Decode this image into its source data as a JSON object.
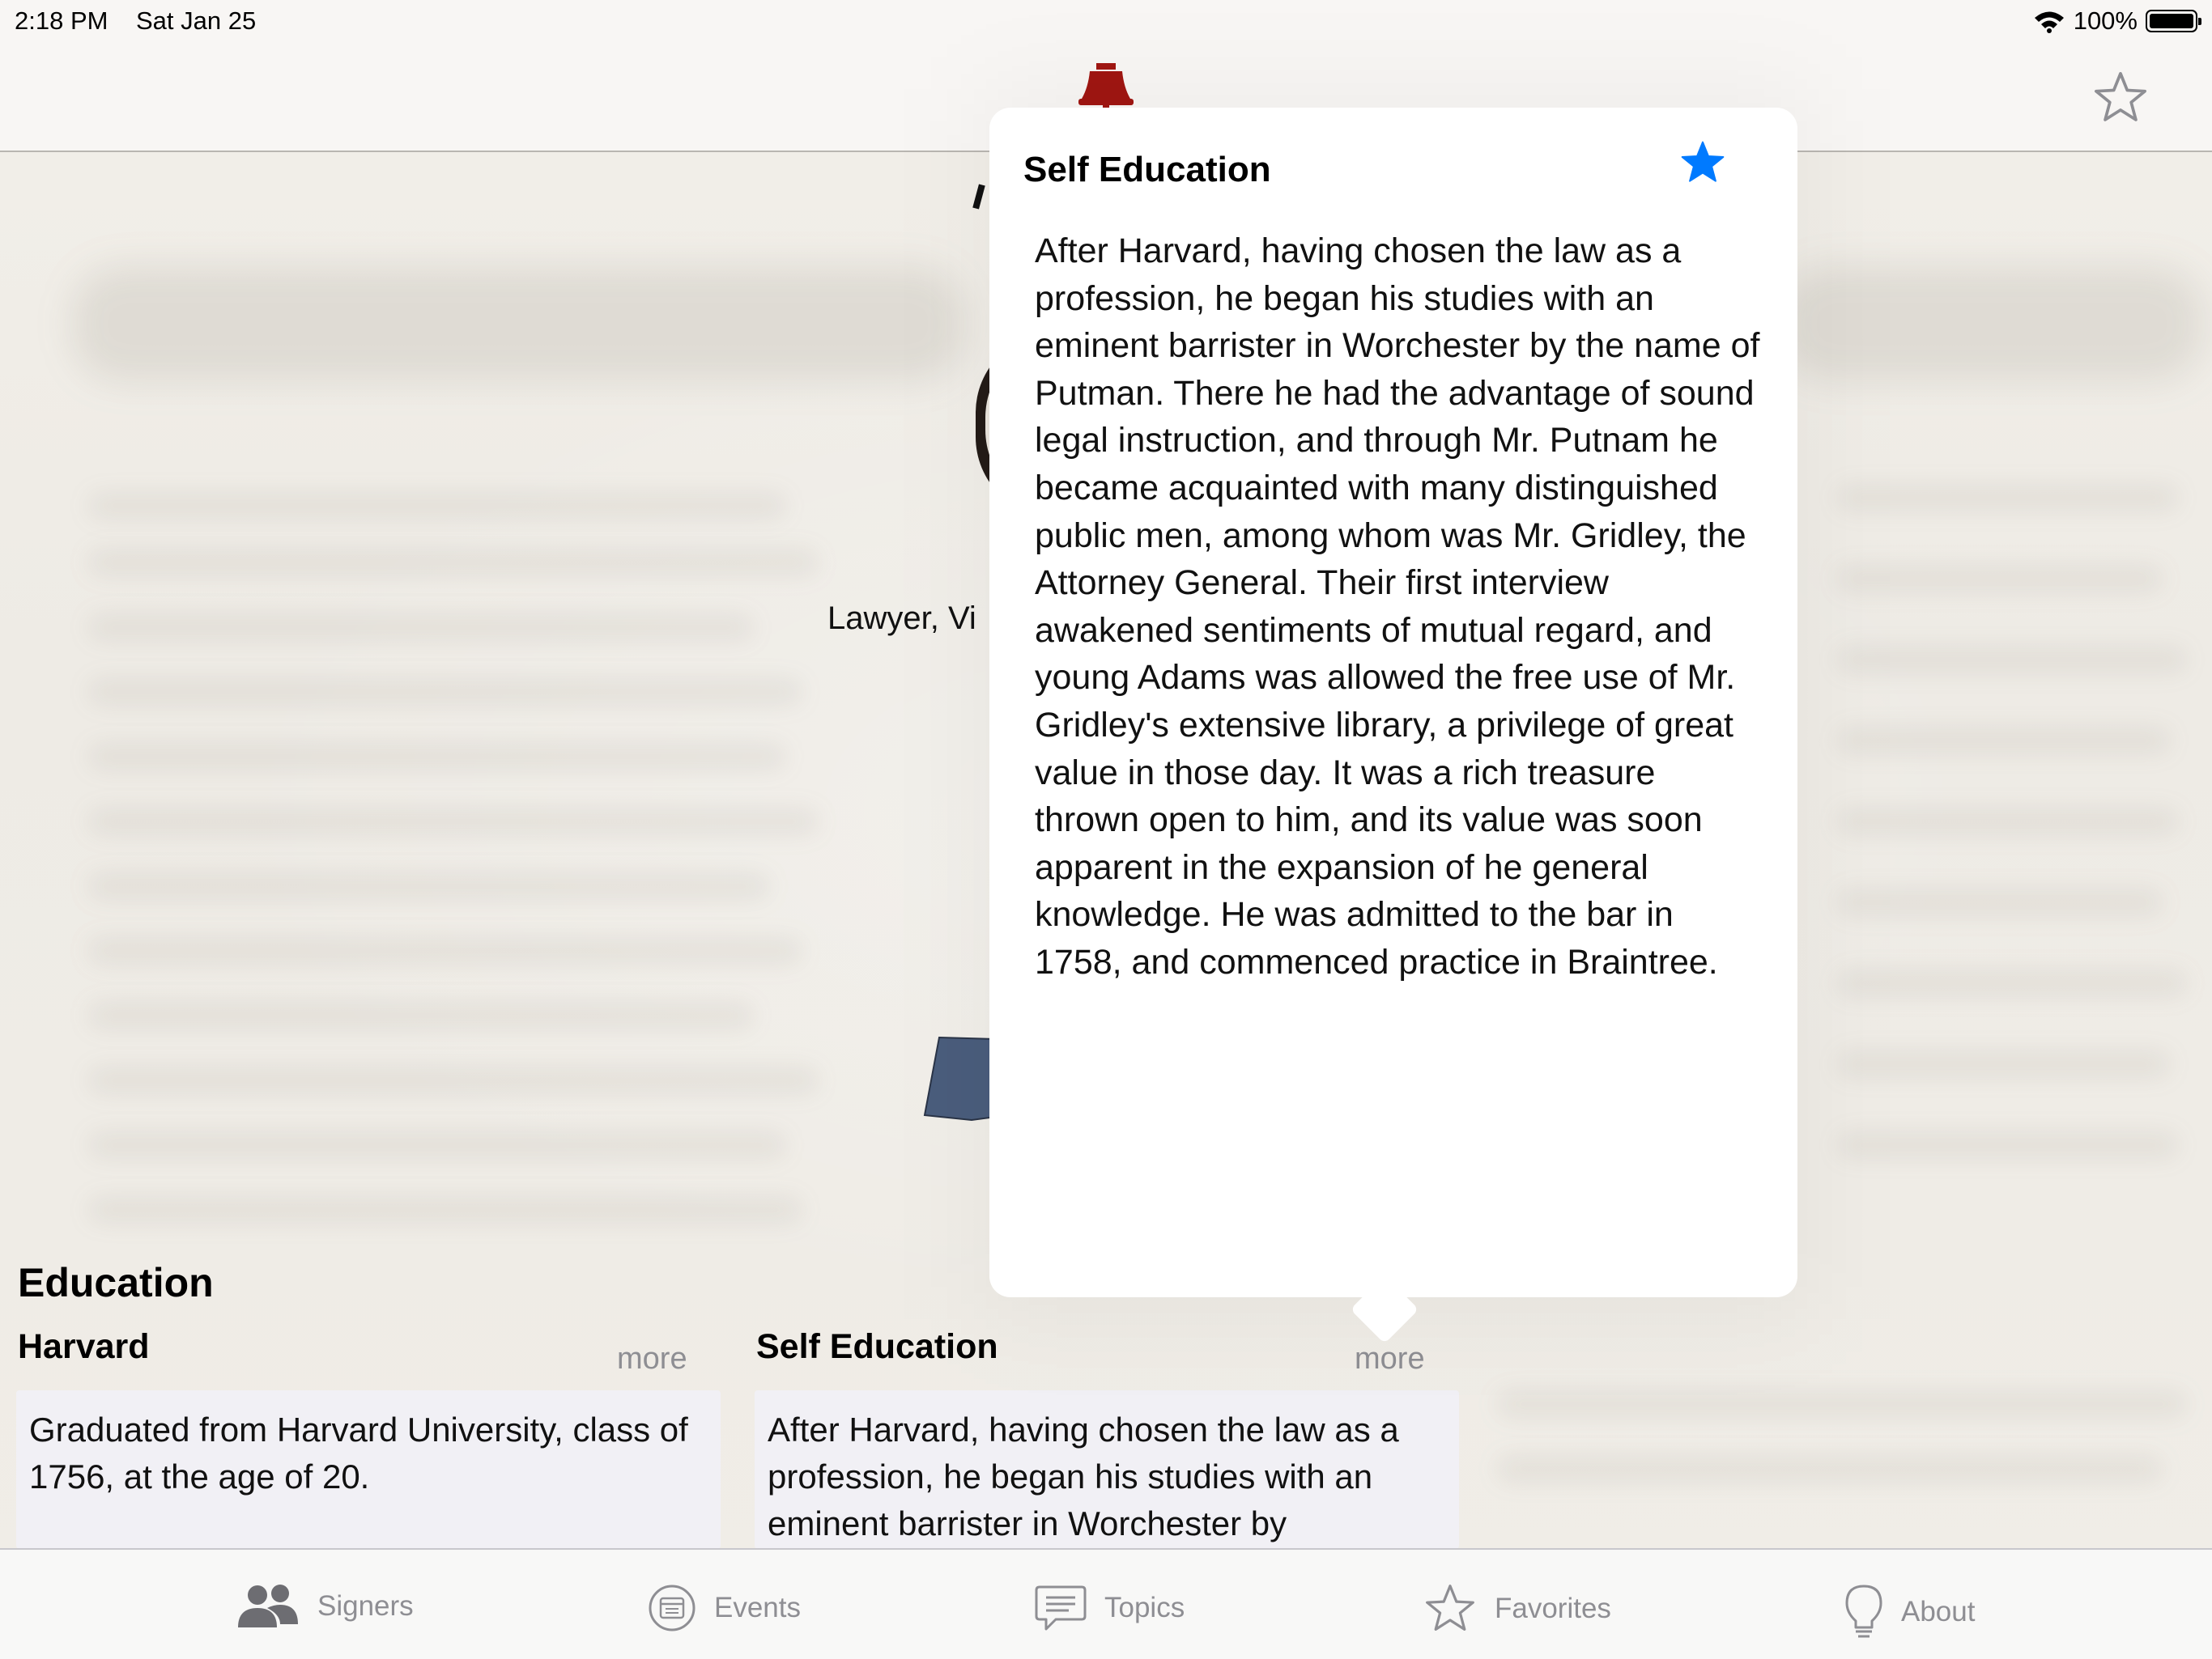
{
  "status_bar": {
    "time": "2:18 PM",
    "date": "Sat Jan 25",
    "battery": "100%"
  },
  "colors": {
    "accent": "#007aff",
    "bell": "#a01612",
    "tab_inactive": "#8e8e93",
    "state": "#4a5d7c"
  },
  "nav": {
    "left_icon": "liberty-bell-icon",
    "right_icon": "star-outline-icon"
  },
  "profile": {
    "subtitle_visible": "Lawyer, Vi"
  },
  "education": {
    "section_title": "Education",
    "cards": [
      {
        "title": "Harvard",
        "more": "more",
        "text": "Graduated from Harvard University, class of 1756, at the age of 20."
      },
      {
        "title": "Self Education",
        "more": "more",
        "text": "After Harvard, having chosen the law as a profession, he began his studies with an eminent barrister in Worchester by"
      }
    ]
  },
  "popover": {
    "title": "Self Education",
    "favorite_icon": "star-filled-icon",
    "body": "After Harvard, having chosen the law as a profession, he began his studies with an eminent barrister in Worchester by the name of Putman. There he had the advantage of sound legal instruction, and through Mr. Putnam he became acquainted with many distinguished public men, among whom was Mr. Gridley, the Attorney General. Their first interview awakened sentiments of mutual regard, and young Adams was allowed the free use of Mr. Gridley's extensive library, a privilege of great value in those day. It was a rich treasure thrown open to him, and its value was soon apparent in the expansion of he general knowledge. He was admitted to the bar in 1758, and commenced practice in Braintree."
  },
  "tabs": [
    {
      "label": "Signers",
      "icon": "people-icon"
    },
    {
      "label": "Events",
      "icon": "calendar-icon"
    },
    {
      "label": "Topics",
      "icon": "chat-bubble-icon"
    },
    {
      "label": "Favorites",
      "icon": "star-outline-icon"
    },
    {
      "label": "About",
      "icon": "lightbulb-icon"
    }
  ]
}
